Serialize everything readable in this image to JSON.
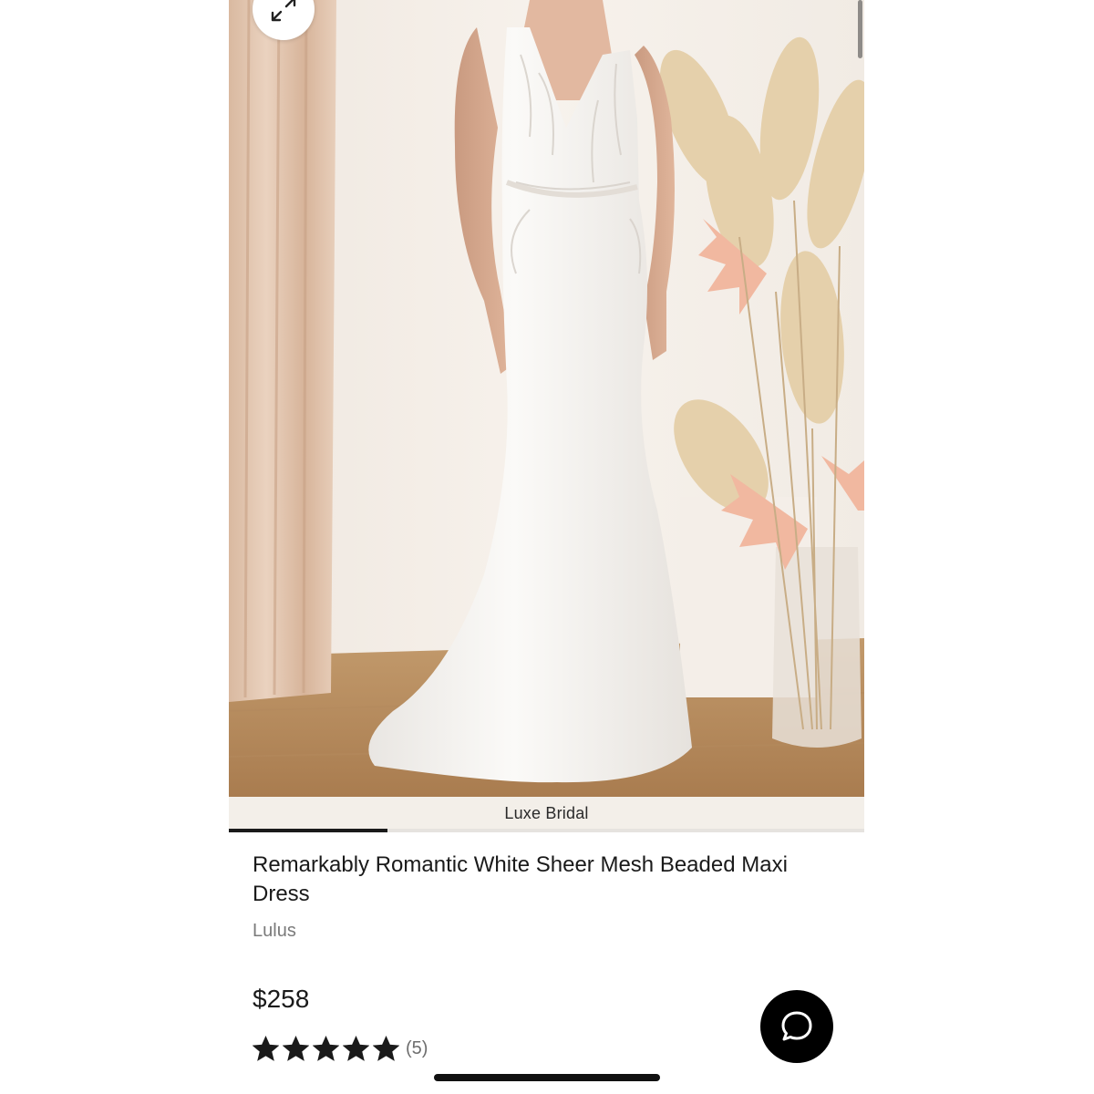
{
  "gallery": {
    "caption": "Luxe Bridal",
    "progress": 0.25,
    "expand_icon": "expand-arrows-icon"
  },
  "product": {
    "title": "Remarkably Romantic White Sheer Mesh Beaded Maxi Dress",
    "brand": "Lulus",
    "price": "$258",
    "rating_value": 5,
    "rating_max": 5,
    "review_count": "(5)"
  },
  "chat": {
    "icon": "chat-bubble-icon"
  },
  "colors": {
    "text": "#1a1a1a",
    "muted": "#7a7a7a",
    "chat_bg": "#000000",
    "caption_bg": "#f3efe9"
  }
}
